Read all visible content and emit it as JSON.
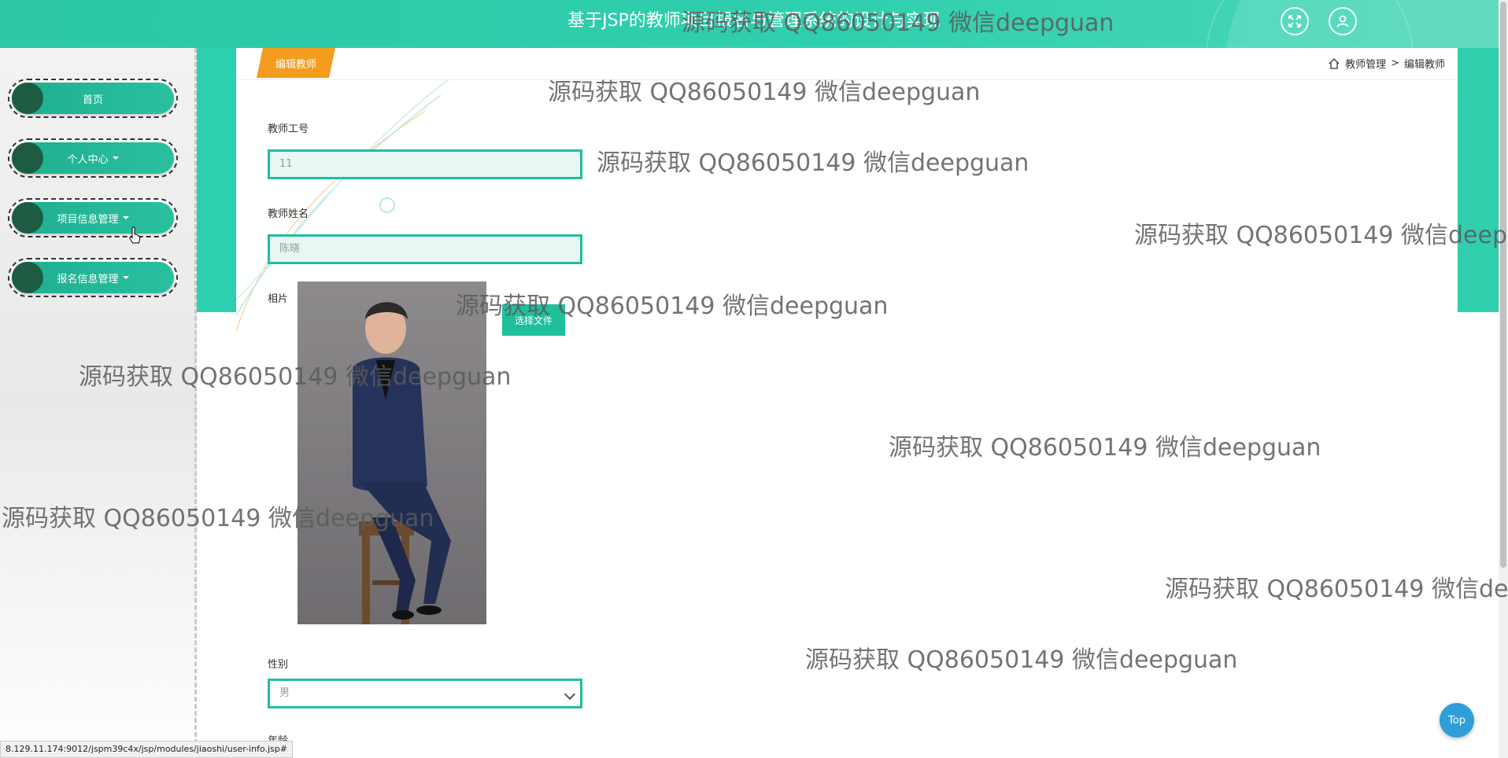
{
  "header": {
    "title": "基于JSP的教师项目报名与管理系统的设计与实现",
    "fullscreen_icon": "fullscreen-icon",
    "user_icon": "user-icon"
  },
  "sidebar": {
    "items": [
      {
        "label": "首页",
        "has_caret": false
      },
      {
        "label": "个人中心",
        "has_caret": true
      },
      {
        "label": "项目信息管理",
        "has_caret": true
      },
      {
        "label": "报名信息管理",
        "has_caret": true
      }
    ]
  },
  "main": {
    "tab_label": "编辑教师",
    "breadcrumb": {
      "home_icon": "home-icon",
      "parent": "教师管理",
      "separator": ">",
      "current": "编辑教师"
    },
    "form": {
      "teacher_no_label": "教师工号",
      "teacher_no_value": "11",
      "teacher_name_label": "教师姓名",
      "teacher_name_value": "陈晓",
      "photo_label": "相片",
      "choose_file_label": "选择文件",
      "gender_label": "性别",
      "gender_value": "男",
      "age_label": "年龄"
    }
  },
  "to_top_label": "Top",
  "status_url": "8.129.11.174:9012/jspm39c4x/jsp/modules/jiaoshi/user-info.jsp#",
  "watermark": "源码获取 QQ86050149 微信deepguan",
  "colors": {
    "primary": "#2cc8a7",
    "accent": "#f39c1e",
    "sidebar_pill": "#1fae90",
    "to_top": "#2e9fd8"
  }
}
